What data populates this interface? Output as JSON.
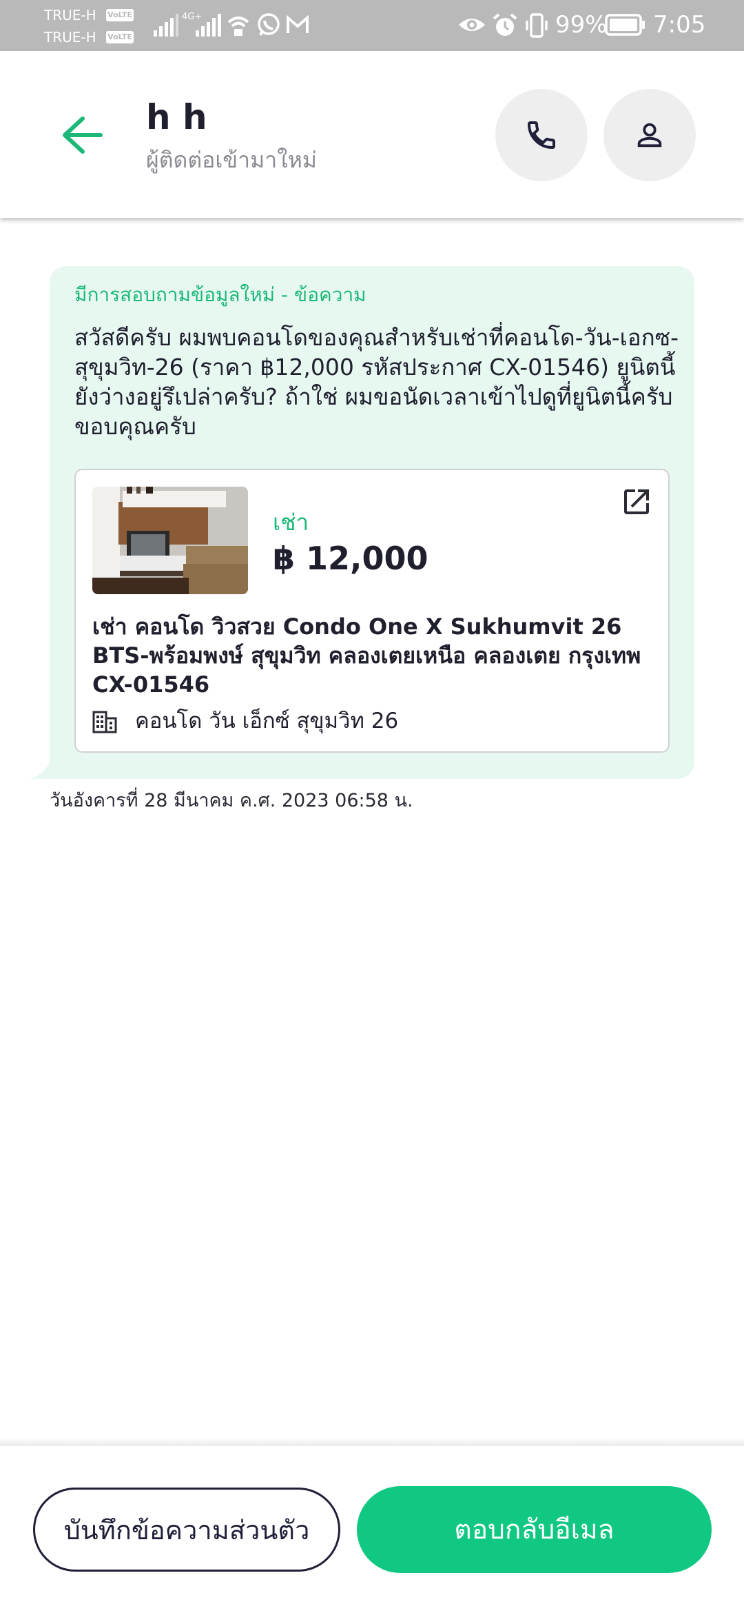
{
  "status_bar": {
    "carrier_1": "TRUE-H",
    "carrier_2": "TRUE-H",
    "volte_label": "VoLTE",
    "network_label": "4G+",
    "battery_percent": "99%",
    "time": "7:05",
    "icons": [
      "signal-icon",
      "wifi-icon",
      "whatsapp-icon",
      "gmail-icon",
      "eye-icon",
      "alarm-icon",
      "vibrate-icon",
      "battery-icon"
    ]
  },
  "header": {
    "contact_name": "h h",
    "contact_subtitle": "ผู้ติดต่อเข้ามาใหม่",
    "icons": [
      "back-arrow-icon",
      "phone-icon",
      "person-icon"
    ]
  },
  "message": {
    "title": "มีการสอบถามข้อมูลใหม่ - ข้อความ",
    "body": "สวัสดีครับ ผมพบคอนโดของคุณสำหรับเช่าที่คอนโด-วัน-เอกซ-สุขุมวิท-26 (ราคา ฿12,000 รหัสประกาศ CX-01546) ยูนิตนี้ยังว่างอยู่รึเปล่าครับ? ถ้าใช่ ผมขอนัดเวลาเข้าไปดูที่ยูนิตนี้ครับ ขอบคุณครับ",
    "timestamp": "วันอังคารที่ 28 มีนาคม ค.ศ. 2023 06:58 น."
  },
  "listing": {
    "type": "เช่า",
    "price": "฿ 12,000",
    "title": "เช่า คอนโด วิวสวย Condo One X Sukhumvit 26 BTS-พร้อมพงษ์ สุขุมวิท คลองเตยเหนือ คลองเตย กรุงเทพ CX-01546",
    "project": "คอนโด วัน เอ็กซ์ สุขุมวิท 26",
    "icons": [
      "external-link-icon",
      "building-icon"
    ]
  },
  "actions": {
    "note_button": "บันทึกข้อความส่วนตัว",
    "reply_button": "ตอบกลับอีเมล"
  },
  "colors": {
    "accent": "#10c882",
    "bubble": "#e7f8f1",
    "status_bar": "#b9b9b9",
    "dark_text": "#1f1f2e"
  }
}
